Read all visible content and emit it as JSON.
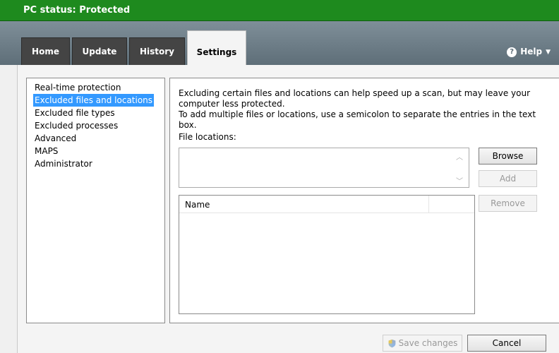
{
  "title_bar": {
    "status": "PC status: Protected"
  },
  "tabs": [
    {
      "label": "Home",
      "active": false
    },
    {
      "label": "Update",
      "active": false
    },
    {
      "label": "History",
      "active": false
    },
    {
      "label": "Settings",
      "active": true
    }
  ],
  "help": {
    "label": "Help",
    "icon": "question-circle-icon"
  },
  "nav": {
    "items": [
      {
        "label": "Real-time protection",
        "selected": false
      },
      {
        "label": "Excluded files and locations",
        "selected": true
      },
      {
        "label": "Excluded file types",
        "selected": false
      },
      {
        "label": "Excluded processes",
        "selected": false
      },
      {
        "label": "Advanced",
        "selected": false
      },
      {
        "label": "MAPS",
        "selected": false
      },
      {
        "label": "Administrator",
        "selected": false
      }
    ]
  },
  "panel": {
    "description_1": "Excluding certain files and locations can help speed up a scan, but may leave your computer less protected.",
    "description_2": "To add multiple files or locations, use a semicolon to separate the entries in the text box.",
    "file_locations_label": "File locations:",
    "file_locations_value": "",
    "browse_label": "Browse",
    "add_label": "Add",
    "remove_label": "Remove",
    "list_header_name": "Name"
  },
  "footer": {
    "save_label": "Save changes",
    "cancel_label": "Cancel"
  },
  "colors": {
    "status_green": "#1e8a1e",
    "selection_blue": "#3399ff",
    "tab_dark": "#444444"
  }
}
